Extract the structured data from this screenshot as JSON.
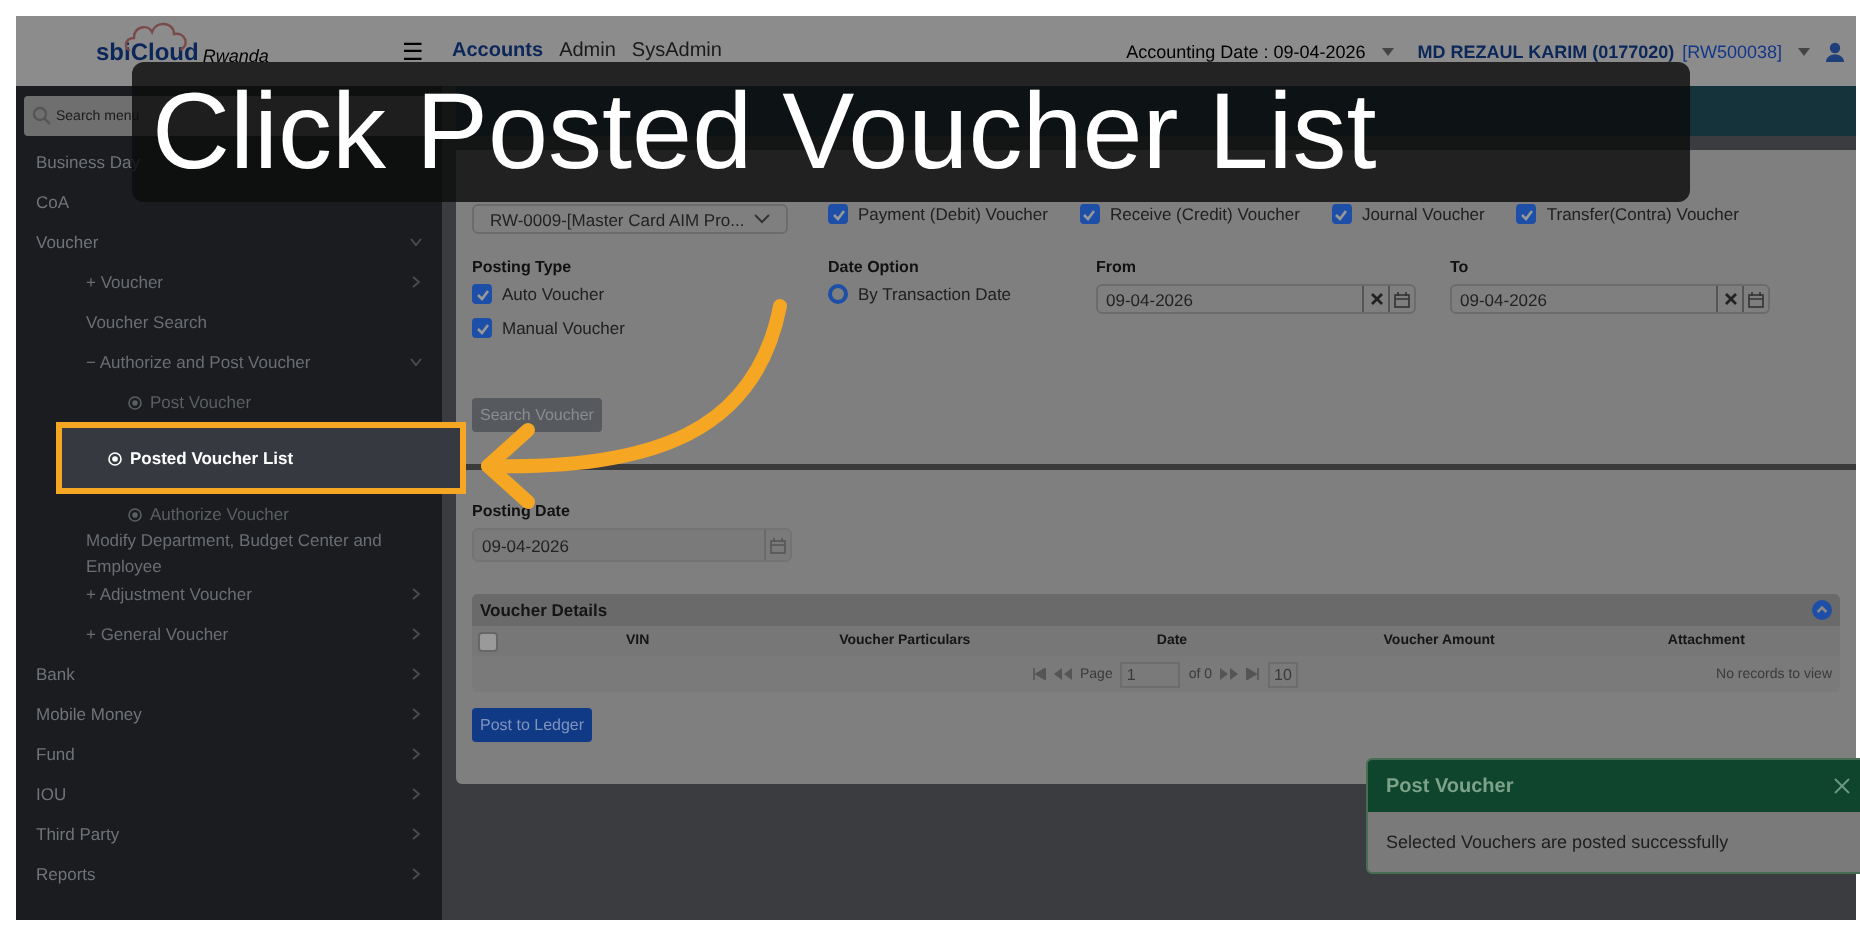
{
  "header": {
    "logo": "sbiCloud",
    "logo_sub": "Rwanda",
    "menu_icon": "☰",
    "nav": [
      {
        "label": "Accounts",
        "selected": true
      },
      {
        "label": "Admin",
        "selected": false
      },
      {
        "label": "SysAdmin",
        "selected": false
      }
    ],
    "accounting_date": "Accounting Date : 09-04-2026",
    "user_name": "MD REZAUL KARIM (0177020)",
    "user_code": "[RW500038]"
  },
  "sidebar": {
    "search": {
      "placeholder": "Search menu"
    },
    "items": [
      {
        "label": "Business Day",
        "kind": "link",
        "selected": false
      },
      {
        "label": "CoA",
        "kind": "link",
        "selected": false
      },
      {
        "label": "Voucher",
        "kind": "group",
        "expanded": true,
        "selected": false,
        "children": [
          {
            "label": "+ Voucher",
            "kind": "group",
            "expanded": false,
            "selected": false
          },
          {
            "label": "Voucher Search",
            "kind": "link",
            "selected": false
          },
          {
            "label": "− Authorize and Post Voucher",
            "kind": "group",
            "expanded": true,
            "selected": false,
            "children": [
              {
                "label": "Post Voucher",
                "kind": "page",
                "selected": false
              },
              {
                "label": "Posted Voucher List",
                "kind": "page",
                "selected": true
              },
              {
                "label": "Authorize Voucher",
                "kind": "page",
                "selected": false
              }
            ]
          },
          {
            "label": "Modify Department, Budget Center and Employee",
            "kind": "link",
            "selected": false
          },
          {
            "label": "+ Adjustment Voucher",
            "kind": "group",
            "expanded": false,
            "selected": false
          },
          {
            "label": "+ General Voucher",
            "kind": "group",
            "expanded": false,
            "selected": false
          }
        ]
      },
      {
        "label": "Bank",
        "kind": "group",
        "expanded": false,
        "selected": false
      },
      {
        "label": "Mobile Money",
        "kind": "group",
        "expanded": false,
        "selected": false
      },
      {
        "label": "Fund",
        "kind": "group",
        "expanded": false,
        "selected": false
      },
      {
        "label": "IOU",
        "kind": "group",
        "expanded": false,
        "selected": false
      },
      {
        "label": "Third Party",
        "kind": "group",
        "expanded": false,
        "selected": false
      },
      {
        "label": "Reports",
        "kind": "group",
        "expanded": false,
        "selected": false
      }
    ]
  },
  "filter": {
    "cost_center": {
      "value": "RW-0009-[Master Card AIM Pro..."
    },
    "voucher_type": {
      "options": [
        {
          "label": "Payment (Debit) Voucher",
          "checked": true
        },
        {
          "label": "Receive (Credit) Voucher",
          "checked": true
        },
        {
          "label": "Journal Voucher",
          "checked": true
        },
        {
          "label": "Transfer(Contra) Voucher",
          "checked": true
        }
      ]
    },
    "posting_type": {
      "label": "Posting Type",
      "options": [
        {
          "label": "Auto Voucher",
          "checked": true
        },
        {
          "label": "Manual Voucher",
          "checked": true
        }
      ]
    },
    "date_option": {
      "label": "Date Option",
      "options": [
        {
          "label": "By Transaction Date",
          "selected": true
        }
      ]
    },
    "from": {
      "label": "From",
      "value": "09-04-2026"
    },
    "to": {
      "label": "To",
      "value": "09-04-2026"
    },
    "search_button": "Search Voucher"
  },
  "posting": {
    "label": "Posting Date",
    "value": "09-04-2026"
  },
  "grid": {
    "title": "Voucher Details",
    "select_all": {
      "checked": false
    },
    "columns": [
      "VIN",
      "Voucher Particulars",
      "Date",
      "Voucher Amount",
      "Attachment"
    ],
    "pager": {
      "page_label": "Page",
      "page": "1",
      "of": "of 0",
      "page_size": "10"
    },
    "empty": "No records to view"
  },
  "post_button": "Post to Ledger",
  "toast": {
    "title": "Post Voucher",
    "message": "Selected Vouchers are posted successfully"
  },
  "tutorial": {
    "title": "Click Posted Voucher List"
  }
}
